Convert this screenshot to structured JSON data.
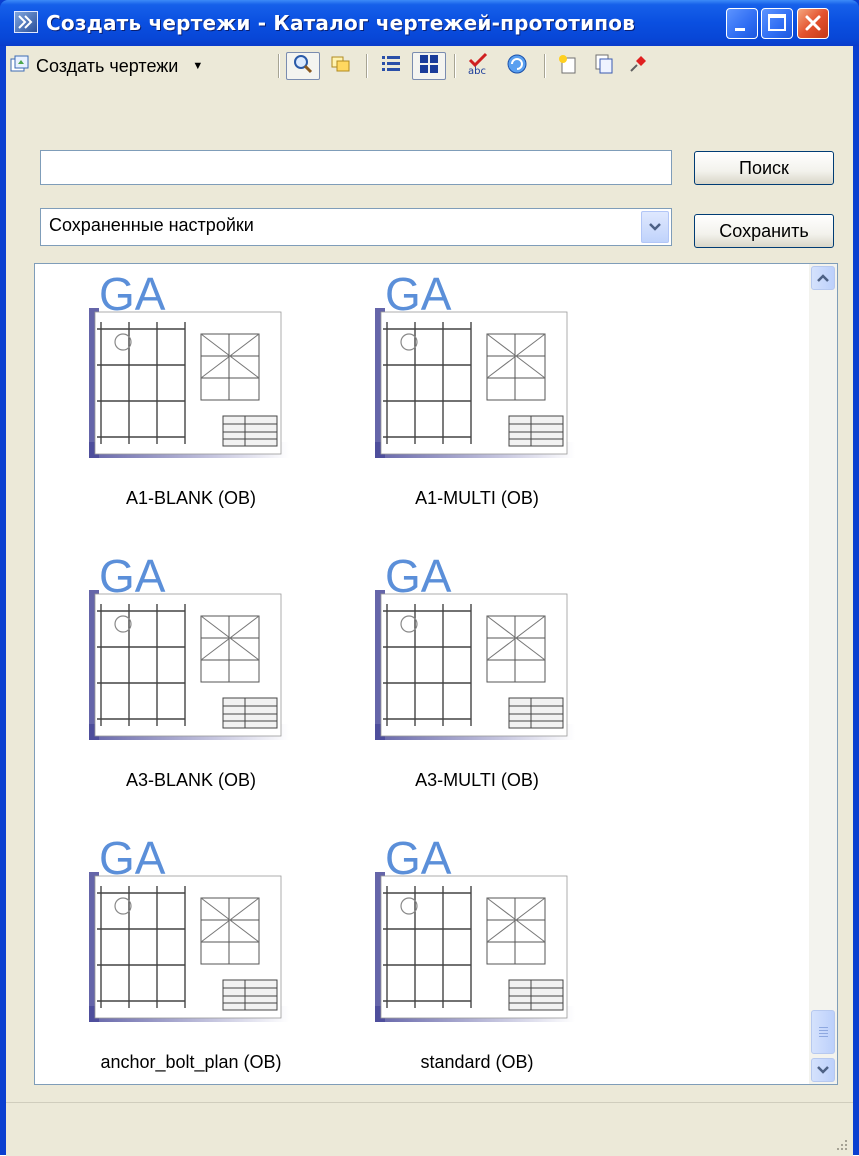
{
  "window": {
    "title": "Создать чертежи - Каталог чертежей-прототипов"
  },
  "toolbar": {
    "create_label": "Создать чертежи",
    "icons": [
      "create-drawings-icon",
      "search-icon",
      "folder-icon",
      "list-view-icon",
      "thumbnail-view-icon",
      "spell-check-icon",
      "refresh-icon",
      "new-item-icon",
      "copy-icon",
      "pin-icon"
    ]
  },
  "search": {
    "value": "",
    "button_label": "Поиск"
  },
  "settings": {
    "selected": "Сохраненные настройки",
    "save_label": "Сохранить"
  },
  "prototypes": [
    {
      "badge": "GA",
      "name": "A1-BLANK (OB)"
    },
    {
      "badge": "GA",
      "name": "A1-MULTI (OB)"
    },
    {
      "badge": "GA",
      "name": "A3-BLANK (OB)"
    },
    {
      "badge": "GA",
      "name": "A3-MULTI (OB)"
    },
    {
      "badge": "GA",
      "name": "anchor_bolt_plan (OB)"
    },
    {
      "badge": "GA",
      "name": "standard (OB)"
    }
  ],
  "colors": {
    "titlebar": "#0a4fe0",
    "badge": "#5b8fd9",
    "shadow": "#4a4a9a"
  }
}
